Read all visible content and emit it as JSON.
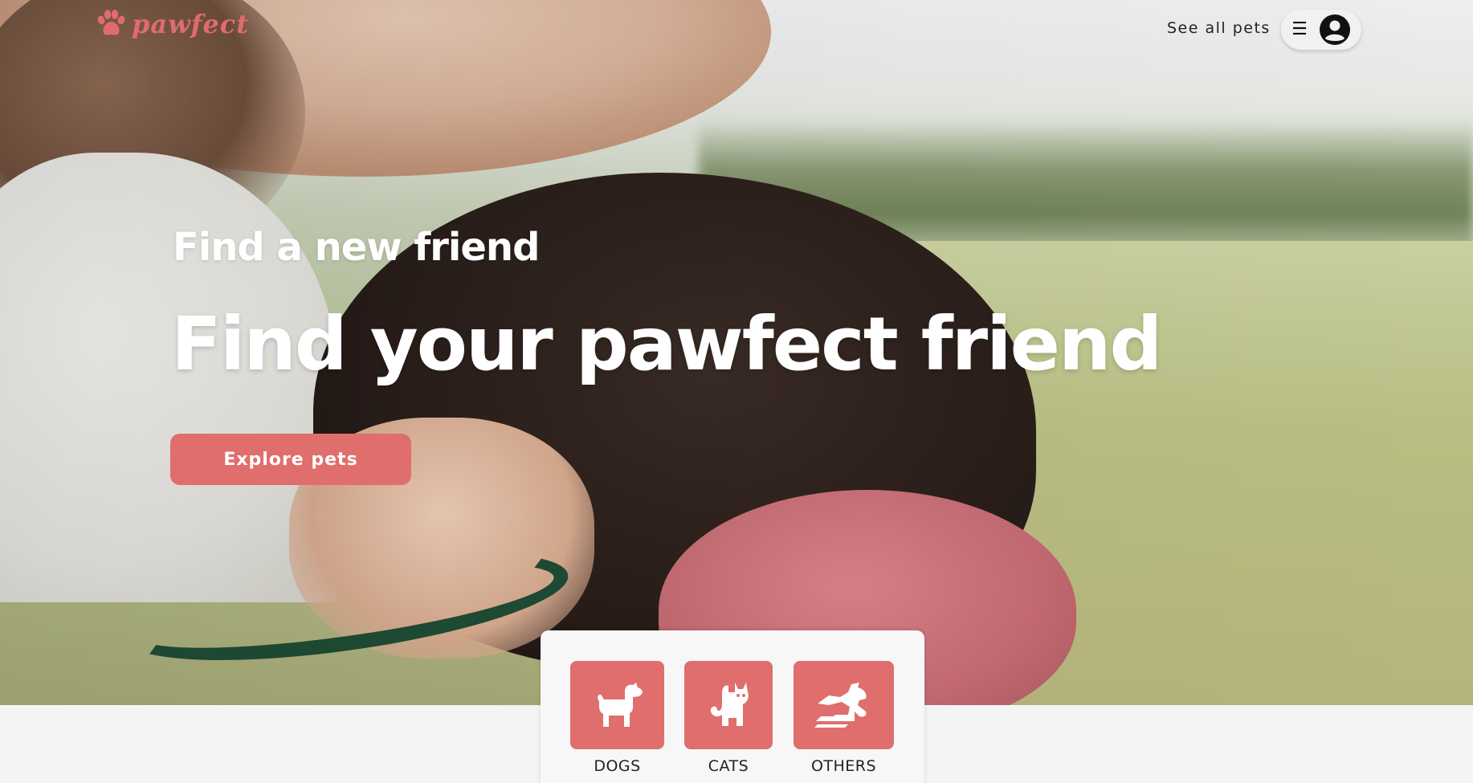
{
  "header": {
    "brand": "pawfect",
    "nav_link": "See all pets",
    "menu_icon": "hamburger-icon",
    "avatar_icon": "user-circle-icon"
  },
  "hero": {
    "eyebrow": "Find a new friend",
    "headline": "Find your pawfect friend",
    "cta_label": "Explore pets",
    "image": "woman-hugging-dog-photo"
  },
  "categories": [
    {
      "label": "DOGS",
      "icon": "dog-icon"
    },
    {
      "label": "CATS",
      "icon": "cat-icon"
    },
    {
      "label": "OTHERS",
      "icon": "dragon-icon"
    }
  ],
  "colors": {
    "accent": "#e06e6c",
    "brand": "#e06b6e",
    "text_dark": "#222222",
    "white": "#ffffff",
    "panel": "#f7f7f8"
  }
}
